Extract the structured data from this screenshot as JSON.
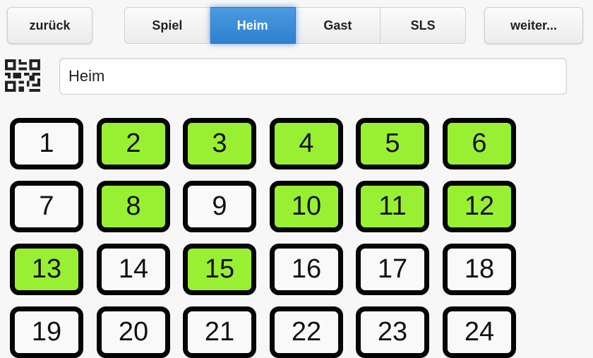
{
  "toolbar": {
    "back_label": "zurück",
    "next_label": "weiter..."
  },
  "tabs": [
    {
      "label": "Spiel",
      "active": false
    },
    {
      "label": "Heim",
      "active": true
    },
    {
      "label": "Gast",
      "active": false
    },
    {
      "label": "SLS",
      "active": false
    }
  ],
  "team_name": {
    "value": "Heim",
    "qr_icon": "qr-code-icon"
  },
  "colors": {
    "selected": "#99f033",
    "unselected": "#f9f9f9",
    "accent": "#2f80cf"
  },
  "players": [
    {
      "number": "1",
      "selected": false
    },
    {
      "number": "2",
      "selected": true
    },
    {
      "number": "3",
      "selected": true
    },
    {
      "number": "4",
      "selected": true
    },
    {
      "number": "5",
      "selected": true
    },
    {
      "number": "6",
      "selected": true
    },
    {
      "number": "7",
      "selected": false
    },
    {
      "number": "8",
      "selected": true
    },
    {
      "number": "9",
      "selected": false
    },
    {
      "number": "10",
      "selected": true
    },
    {
      "number": "11",
      "selected": true
    },
    {
      "number": "12",
      "selected": true
    },
    {
      "number": "13",
      "selected": true
    },
    {
      "number": "14",
      "selected": false
    },
    {
      "number": "15",
      "selected": true
    },
    {
      "number": "16",
      "selected": false
    },
    {
      "number": "17",
      "selected": false
    },
    {
      "number": "18",
      "selected": false
    },
    {
      "number": "19",
      "selected": false
    },
    {
      "number": "20",
      "selected": false
    },
    {
      "number": "21",
      "selected": false
    },
    {
      "number": "22",
      "selected": false
    },
    {
      "number": "23",
      "selected": false
    },
    {
      "number": "24",
      "selected": false
    }
  ]
}
